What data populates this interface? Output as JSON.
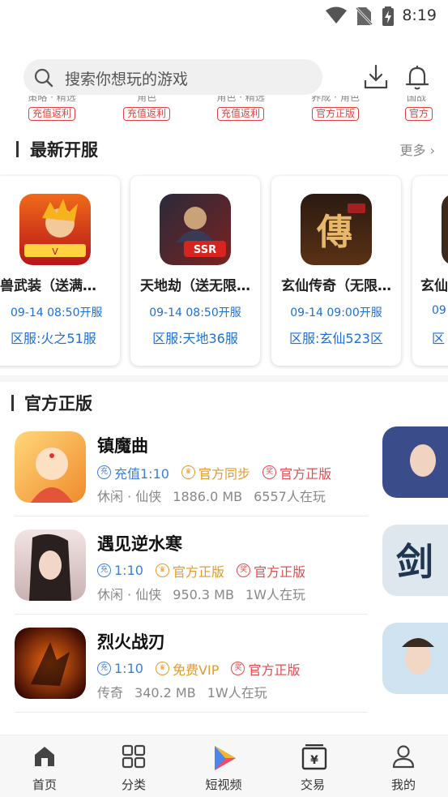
{
  "status_bar": {
    "time": "8:19"
  },
  "search": {
    "placeholder": "搜索你想玩的游戏"
  },
  "tag_strip": [
    {
      "cut_text": "策略 · 精选",
      "tag": "充值返利"
    },
    {
      "cut_text": "角色",
      "tag": "充值返利"
    },
    {
      "cut_text": "角色 · 精选",
      "tag": "充值返利"
    },
    {
      "cut_text": "养成 · 角色",
      "tag": "官方正版"
    },
    {
      "cut_text": "国战",
      "tag": "官方"
    }
  ],
  "new_servers": {
    "title": "最新开服",
    "more": "更多",
    "cards": [
      {
        "name": "兽武装（送满…",
        "time": "09-14 08:50开服",
        "server": "区服:火之51服"
      },
      {
        "name": "天地劫（送无限…",
        "time": "09-14 08:50开服",
        "server": "区服:天地36服"
      },
      {
        "name": "玄仙传奇（无限…",
        "time": "09-14 09:00开服",
        "server": "区服:玄仙523区"
      },
      {
        "name": "玄仙",
        "time": "09",
        "server": "区"
      }
    ]
  },
  "official": {
    "title": "官方正版",
    "games": [
      {
        "name": "镇魔曲",
        "tags": [
          {
            "glyph": "充",
            "text": "充值1:10",
            "color": "blue"
          },
          {
            "glyph": "♛",
            "text": "官方同步",
            "color": "gold"
          },
          {
            "glyph": "奖",
            "text": "官方正版",
            "color": "red"
          }
        ],
        "genre": "休闲 · 仙侠",
        "size": "1886.0 MB",
        "players": "6557人在玩"
      },
      {
        "name": "遇见逆水寒",
        "tags": [
          {
            "glyph": "充",
            "text": "1:10",
            "color": "blue"
          },
          {
            "glyph": "♛",
            "text": "官方正版",
            "color": "gold"
          },
          {
            "glyph": "奖",
            "text": "官方正版",
            "color": "red"
          }
        ],
        "genre": "休闲 · 仙侠",
        "size": "950.3 MB",
        "players": "1W人在玩"
      },
      {
        "name": "烈火战刃",
        "tags": [
          {
            "glyph": "充",
            "text": "1:10",
            "color": "blue"
          },
          {
            "glyph": "♛",
            "text": "免费VIP",
            "color": "gold"
          },
          {
            "glyph": "奖",
            "text": "官方正版",
            "color": "red"
          }
        ],
        "genre": "传奇",
        "size": "340.2 MB",
        "players": "1W人在玩"
      }
    ]
  },
  "tabs": [
    {
      "label": "首页",
      "icon": "home-icon"
    },
    {
      "label": "分类",
      "icon": "grid-icon"
    },
    {
      "label": "短视频",
      "icon": "play-icon"
    },
    {
      "label": "交易",
      "icon": "trade-icon"
    },
    {
      "label": "我的",
      "icon": "profile-icon"
    }
  ],
  "colors": {
    "accent_blue": "#1e6fd9",
    "tag_red": "#e8413d",
    "tag_gold": "#e39a2c"
  }
}
